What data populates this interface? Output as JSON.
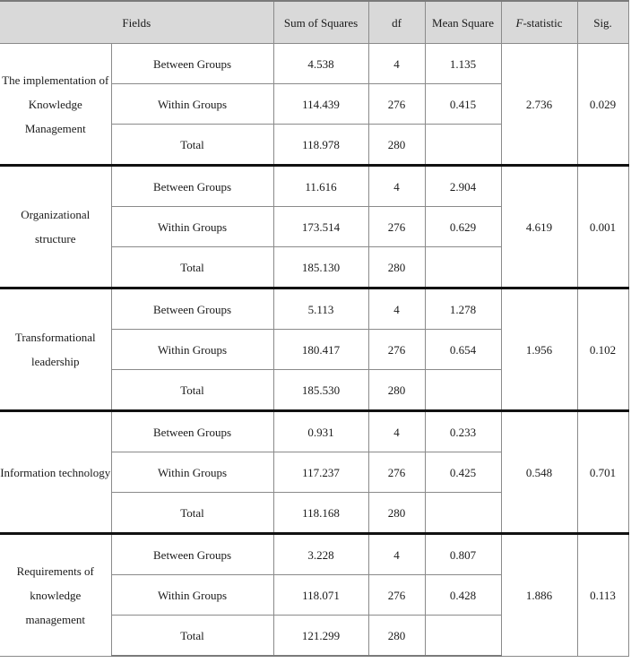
{
  "table": {
    "headers": {
      "fields": "Fields",
      "sum_of_squares": "Sum of Squares",
      "df": "df",
      "mean_square": "Mean Square",
      "f_statistic_italic": "F",
      "f_statistic_rest": "-statistic",
      "sig": "Sig."
    },
    "sections": [
      {
        "field": "The implementation of Knowledge Management",
        "rows": [
          {
            "group": "Between Groups",
            "ss": "4.538",
            "df": "4",
            "ms": "1.135"
          },
          {
            "group": "Within Groups",
            "ss": "114.439",
            "df": "276",
            "ms": "0.415"
          },
          {
            "group": "Total",
            "ss": "118.978",
            "df": "280",
            "ms": ""
          }
        ],
        "f": "2.736",
        "sig": "0.029"
      },
      {
        "field": "Organizational structure",
        "rows": [
          {
            "group": "Between Groups",
            "ss": "11.616",
            "df": "4",
            "ms": "2.904"
          },
          {
            "group": "Within Groups",
            "ss": "173.514",
            "df": "276",
            "ms": "0.629"
          },
          {
            "group": "Total",
            "ss": "185.130",
            "df": "280",
            "ms": ""
          }
        ],
        "f": "4.619",
        "sig": "0.001"
      },
      {
        "field": "Transformational leadership",
        "rows": [
          {
            "group": "Between Groups",
            "ss": "5.113",
            "df": "4",
            "ms": "1.278"
          },
          {
            "group": "Within Groups",
            "ss": "180.417",
            "df": "276",
            "ms": "0.654"
          },
          {
            "group": "Total",
            "ss": "185.530",
            "df": "280",
            "ms": ""
          }
        ],
        "f": "1.956",
        "sig": "0.102"
      },
      {
        "field": "Information technology",
        "rows": [
          {
            "group": "Between Groups",
            "ss": "0.931",
            "df": "4",
            "ms": "0.233"
          },
          {
            "group": "Within Groups",
            "ss": "117.237",
            "df": "276",
            "ms": "0.425"
          },
          {
            "group": "Total",
            "ss": "118.168",
            "df": "280",
            "ms": ""
          }
        ],
        "f": "0.548",
        "sig": "0.701"
      },
      {
        "field": "Requirements of knowledge management",
        "rows": [
          {
            "group": "Between Groups",
            "ss": "3.228",
            "df": "4",
            "ms": "0.807"
          },
          {
            "group": "Within Groups",
            "ss": "118.071",
            "df": "276",
            "ms": "0.428"
          },
          {
            "group": "Total",
            "ss": "121.299",
            "df": "280",
            "ms": ""
          }
        ],
        "f": "1.886",
        "sig": "0.113"
      }
    ]
  }
}
